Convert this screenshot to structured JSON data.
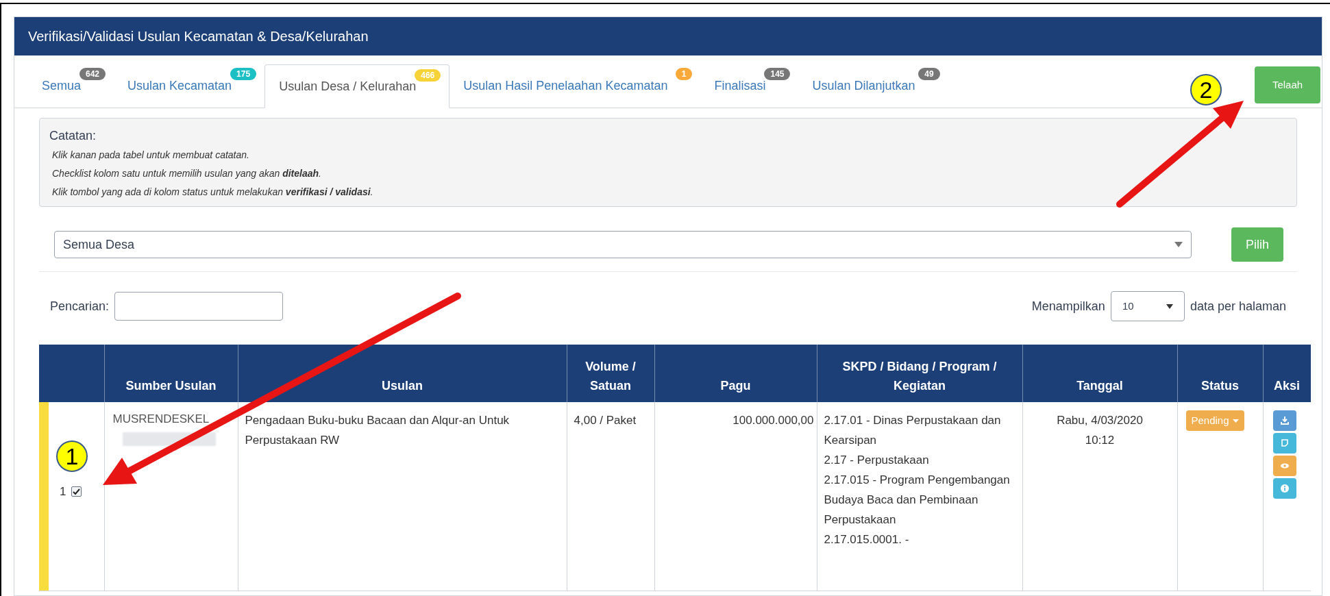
{
  "panel": {
    "title": "Verifikasi/Validasi Usulan Kecamatan & Desa/Kelurahan"
  },
  "tabs": [
    {
      "label": "Semua",
      "count": "642",
      "color": "#777777",
      "selected": false
    },
    {
      "label": "Usulan Kecamatan",
      "count": "175",
      "color": "#1bbfc4",
      "selected": false
    },
    {
      "label": "Usulan Desa / Kelurahan",
      "count": "466",
      "color": "#f7d33a",
      "selected": true
    },
    {
      "label": "Usulan Hasil Penelaahan Kecamatan",
      "count": "1",
      "color": "#f9a93a",
      "selected": false
    },
    {
      "label": "Finalisasi",
      "count": "145",
      "color": "#777777",
      "selected": false
    },
    {
      "label": "Usulan Dilanjutkan",
      "count": "49",
      "color": "#777777",
      "selected": false
    }
  ],
  "telaah_button": "Telaah",
  "notes": {
    "title": "Catatan:",
    "lines": [
      "Klik kanan pada tabel untuk membuat catatan.",
      "Checklist kolom satu untuk memilih usulan yang akan **ditelaah**.",
      "Klik tombol yang ada di kolom status untuk melakukan **verifikasi / validasi**."
    ]
  },
  "desa_select": {
    "value": "Semua Desa"
  },
  "pilih_button": "Pilih",
  "search": {
    "label": "Pencarian:"
  },
  "page_size": {
    "label_before": "Menampilkan",
    "value": "10",
    "label_after": "data per halaman"
  },
  "table": {
    "columns": [
      "Sumber Usulan",
      "Usulan",
      "Volume / Satuan",
      "Pagu",
      "SKPD / Bidang / Program / Kegiatan",
      "Tanggal",
      "Status",
      "Aksi"
    ],
    "rows": [
      {
        "number": "1",
        "checked": true,
        "color": "#f9dc3e",
        "sumber": "MUSRENDESKEL",
        "usulan": "Pengadaan Buku-buku Bacaan dan Alqur-an Untuk Perpustakaan RW",
        "volume": "4,00 / Paket",
        "pagu": "100.000.000,00",
        "skpd": [
          "2.17.01 - Dinas Perpustakaan dan Kearsipan",
          "2.17 - Perpustakaan",
          "2.17.015 - Program Pengembangan Budaya Baca dan Pembinaan Perpustakaan",
          "2.17.015.0001. -"
        ],
        "tanggal": [
          "Rabu, 4/03/2020",
          "10:12"
        ],
        "status": "Pending"
      }
    ]
  },
  "annotations": [
    {
      "label": "1"
    },
    {
      "label": "2"
    }
  ]
}
